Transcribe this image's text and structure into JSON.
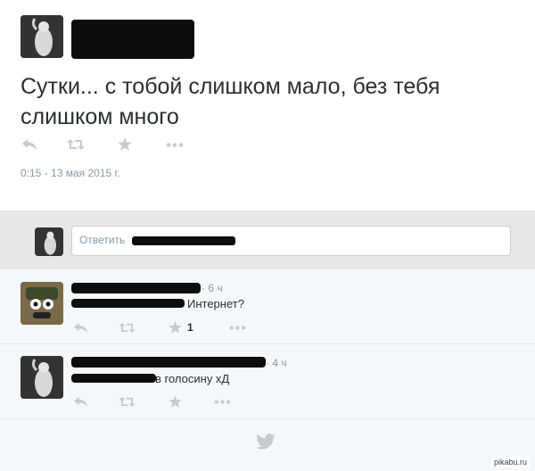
{
  "tweet": {
    "text": "Сутки... с тобой слишком мало, без тебя слишком много",
    "timestamp": "0:15 - 13 мая 2015 г.",
    "actions": [
      "reply-icon",
      "retweet-icon",
      "favorite-icon",
      "more-icon"
    ]
  },
  "reply_box": {
    "placeholder": "Ответить"
  },
  "replies": [
    {
      "time": "· 6 ч",
      "text": "Интернет?",
      "favorite_count": "1"
    },
    {
      "time": "· 4 ч",
      "text": "в голосину хД",
      "favorite_count": ""
    }
  ],
  "footer": {
    "icon": "twitter-bird-icon"
  },
  "watermark": "pikabu.ru",
  "colors": {
    "icon": "#c5cbd0",
    "bird": "#c5cbd0",
    "meta": "#8899a6",
    "text": "#292f33",
    "reply_bg": "#f5f8fa"
  }
}
